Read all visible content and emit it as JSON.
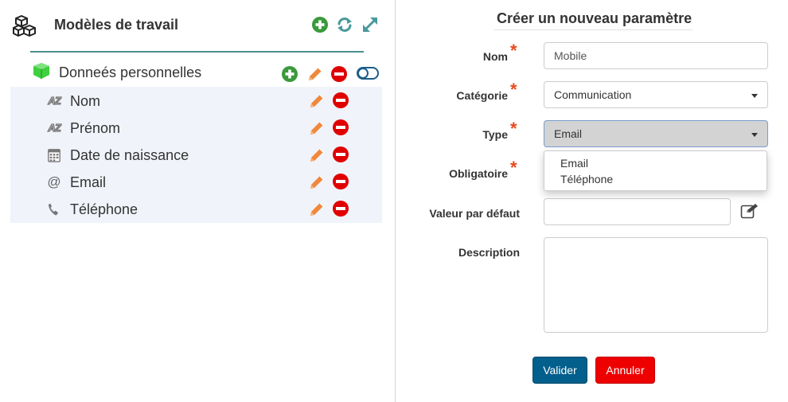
{
  "left_panel": {
    "title": "Modèles de travail",
    "group": {
      "label": "Donneés personnelles"
    },
    "fields": [
      {
        "label": "Nom",
        "icon": "az-text-icon"
      },
      {
        "label": "Prénom",
        "icon": "az-text-icon"
      },
      {
        "label": "Date de naissance",
        "icon": "calendar-icon"
      },
      {
        "label": "Email",
        "icon": "at-icon"
      },
      {
        "label": "Téléphone",
        "icon": "phone-icon"
      }
    ],
    "at_glyph": "@"
  },
  "form": {
    "title": "Créer un nouveau paramètre",
    "required_mark": "*",
    "nom": {
      "label": "Nom",
      "value": "Mobile"
    },
    "categorie": {
      "label": "Catégorie",
      "value": "Communication"
    },
    "type": {
      "label": "Type",
      "value": "Email",
      "options": [
        "Email",
        "Téléphone"
      ]
    },
    "obligatoire": {
      "label": "Obligatoire"
    },
    "valeur_defaut": {
      "label": "Valeur par défaut",
      "value": ""
    },
    "description": {
      "label": "Description",
      "value": ""
    },
    "validate_label": "Valider",
    "cancel_label": "Annuler"
  },
  "colors": {
    "add_green": "#3a9a3a",
    "sync_teal": "#4a9a9a",
    "edit_orange": "#f0883c",
    "delete_red": "#e00000",
    "required_star": "#e8481c",
    "validate_blue": "#035f8b",
    "cancel_red": "#ee0000",
    "list_bg": "#f0f3fa"
  }
}
